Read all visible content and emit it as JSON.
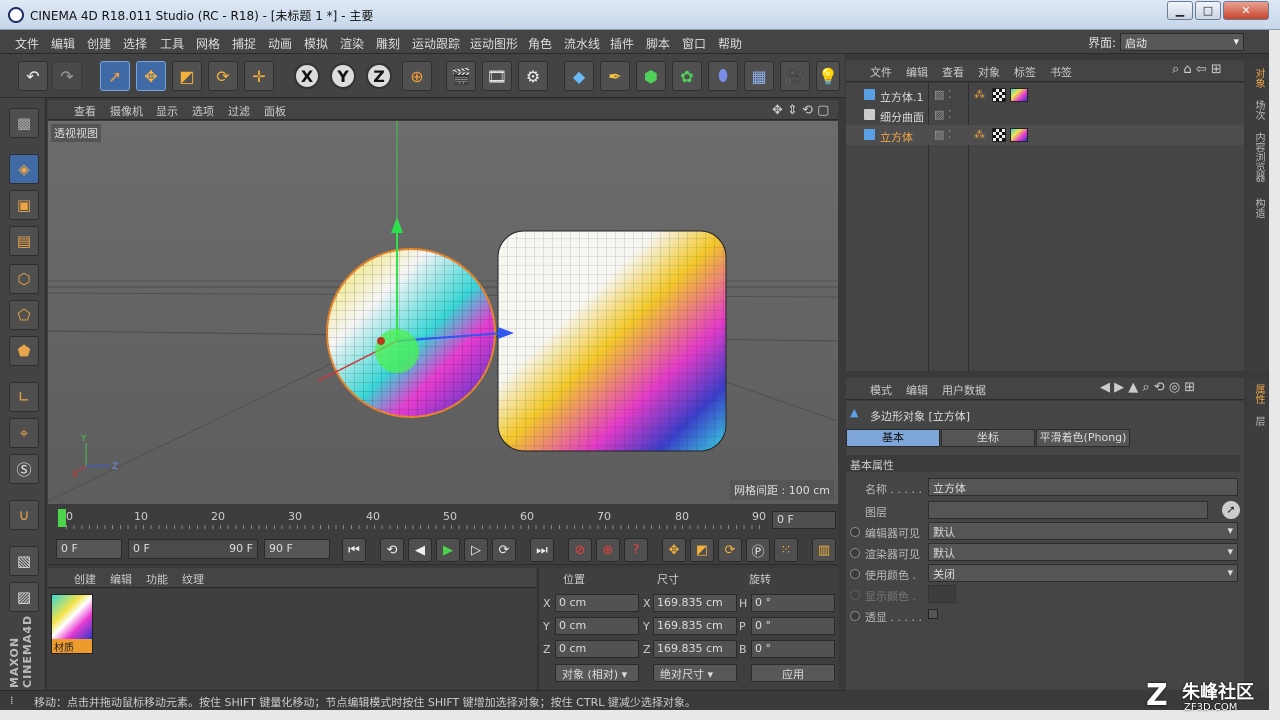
{
  "window": {
    "title": "CINEMA 4D R18.011 Studio (RC - R18) - [未标题 1 *] - 主要"
  },
  "menubar": {
    "items": [
      "文件",
      "编辑",
      "创建",
      "选择",
      "工具",
      "网格",
      "捕捉",
      "动画",
      "模拟",
      "渲染",
      "雕刻",
      "运动跟踪",
      "运动图形",
      "角色",
      "流水线",
      "插件",
      "脚本",
      "窗口",
      "帮助"
    ],
    "layout_label": "界面:",
    "layout_value": "启动"
  },
  "viewport": {
    "menu": [
      "查看",
      "摄像机",
      "显示",
      "选项",
      "过滤",
      "面板"
    ],
    "view_label": "透视视图",
    "grid_spacing": "网格间距 : 100 cm",
    "axis_labels": {
      "y": "Y",
      "x": "X",
      "z": "Z"
    }
  },
  "timeline": {
    "ticks": [
      "0",
      "10",
      "20",
      "30",
      "40",
      "50",
      "60",
      "70",
      "80",
      "90"
    ],
    "current_frame": "0 F"
  },
  "transport": {
    "start": "0 F",
    "range_start": "0 F",
    "range_end": "90 F",
    "end": "90 F"
  },
  "material_manager": {
    "menu": [
      "创建",
      "编辑",
      "功能",
      "纹理"
    ],
    "materials": [
      {
        "name": "材质"
      }
    ]
  },
  "coordinates": {
    "headers": {
      "position": "位置",
      "size": "尺寸",
      "rotation": "旋转"
    },
    "rows": [
      {
        "axis": "X",
        "pos": "0 cm",
        "size_axis": "X",
        "size": "169.835 cm",
        "rot_axis": "H",
        "rot": "0 °"
      },
      {
        "axis": "Y",
        "pos": "0 cm",
        "size_axis": "Y",
        "size": "169.835 cm",
        "rot_axis": "P",
        "rot": "0 °"
      },
      {
        "axis": "Z",
        "pos": "0 cm",
        "size_axis": "Z",
        "size": "169.835 cm",
        "rot_axis": "B",
        "rot": "0 °"
      }
    ],
    "mode_select": "对象 (相对)",
    "size_select": "绝对尺寸",
    "apply_label": "应用"
  },
  "object_manager": {
    "menu": [
      "文件",
      "编辑",
      "查看",
      "对象",
      "标签",
      "书签"
    ],
    "objects": [
      {
        "name": "立方体.1",
        "active": false,
        "color": "#5aa0e6"
      },
      {
        "name": "细分曲面",
        "active": false,
        "color": "#cccccc"
      },
      {
        "name": "立方体",
        "active": true,
        "color": "#5aa0e6"
      }
    ],
    "side_tabs": [
      "对象",
      "场次",
      "内容浏览器",
      "构造"
    ]
  },
  "attribute_manager": {
    "menu": [
      "模式",
      "编辑",
      "用户数据"
    ],
    "title": "多边形对象 [立方体]",
    "tabs": [
      "基本",
      "坐标",
      "平滑着色(Phong)"
    ],
    "section": "基本属性",
    "fields": [
      {
        "label": "名称 . . . . .",
        "value": "立方体"
      },
      {
        "label": "图层",
        "value": ""
      },
      {
        "label": "编辑器可见",
        "value": "默认"
      },
      {
        "label": "渲染器可见",
        "value": "默认"
      },
      {
        "label": "使用颜色 .",
        "value": "关闭"
      },
      {
        "label": "显示颜色 .",
        "value": ""
      },
      {
        "label": "透显 . . . . .",
        "value": ""
      }
    ],
    "side_tabs": [
      "属性",
      "层"
    ]
  },
  "status": {
    "text": "移动：点击并拖动鼠标移动元素。按住 SHIFT 键量化移动；节点编辑模式时按住 SHIFT 键增加选择对象；按住 CTRL 键减少选择对象。"
  },
  "watermark": {
    "brand": "朱峰社区",
    "site": "ZF3D.COM"
  },
  "colors": {
    "accent": "#3f6aa6",
    "active_object": "#f0a84a",
    "panel_bg": "#454545"
  }
}
